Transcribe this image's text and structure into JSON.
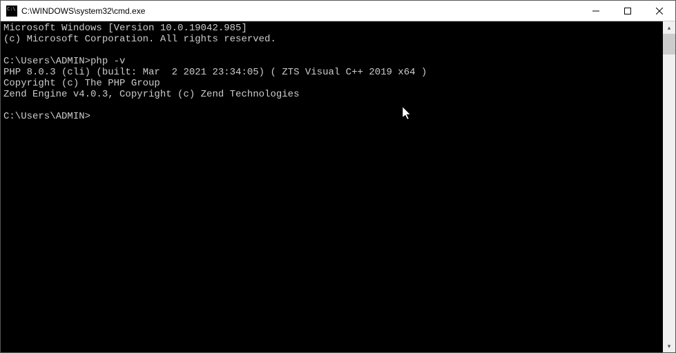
{
  "titlebar": {
    "title": "C:\\WINDOWS\\system32\\cmd.exe"
  },
  "terminal": {
    "line1": "Microsoft Windows [Version 10.0.19042.985]",
    "line2": "(c) Microsoft Corporation. All rights reserved.",
    "prompt1_path": "C:\\Users\\ADMIN>",
    "prompt1_cmd": "php -v",
    "output1": "PHP 8.0.3 (cli) (built: Mar  2 2021 23:34:05) ( ZTS Visual C++ 2019 x64 )",
    "output2": "Copyright (c) The PHP Group",
    "output3": "Zend Engine v4.0.3, Copyright (c) Zend Technologies",
    "prompt2_path": "C:\\Users\\ADMIN>"
  },
  "icons": {
    "minimize": "minimize-icon",
    "maximize": "maximize-icon",
    "close": "close-icon",
    "scroll_up": "▴",
    "scroll_down": "▾"
  }
}
